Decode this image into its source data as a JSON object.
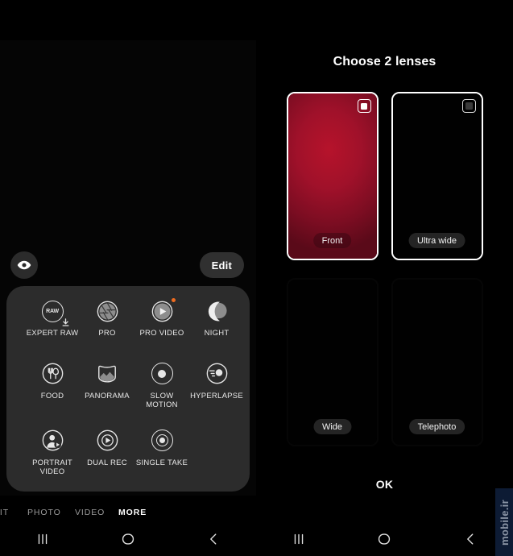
{
  "left": {
    "eye_icon": "eye-icon",
    "edit_label": "Edit",
    "modes": [
      {
        "label": "EXPERT RAW",
        "icon": "raw-download-icon",
        "badge": false
      },
      {
        "label": "PRO",
        "icon": "aperture-icon",
        "badge": false
      },
      {
        "label": "PRO VIDEO",
        "icon": "play-circle-icon",
        "badge": true
      },
      {
        "label": "NIGHT",
        "icon": "moon-icon",
        "badge": false
      },
      {
        "label": "FOOD",
        "icon": "fork-spoon-icon",
        "badge": false
      },
      {
        "label": "PANORAMA",
        "icon": "panorama-icon",
        "badge": false
      },
      {
        "label": "SLOW\nMOTION",
        "icon": "slow-motion-icon",
        "badge": false
      },
      {
        "label": "HYPERLAPSE",
        "icon": "hyperlapse-icon",
        "badge": false
      },
      {
        "label": "PORTRAIT\nVIDEO",
        "icon": "portrait-video-icon",
        "badge": false
      },
      {
        "label": "DUAL REC",
        "icon": "dual-rec-icon",
        "badge": false
      },
      {
        "label": "SINGLE TAKE",
        "icon": "single-take-icon",
        "badge": false
      }
    ],
    "tabs": [
      {
        "label": "AIT",
        "active": false
      },
      {
        "label": "PHOTO",
        "active": false
      },
      {
        "label": "VIDEO",
        "active": false
      },
      {
        "label": "MORE",
        "active": true
      }
    ]
  },
  "right": {
    "title": "Choose 2 lenses",
    "lenses": [
      {
        "label": "Front",
        "selected": true,
        "checkbox": "checked",
        "preview": "red"
      },
      {
        "label": "Ultra wide",
        "selected": true,
        "checkbox": "unchecked",
        "preview": "black"
      },
      {
        "label": "Wide",
        "selected": false,
        "checkbox": "none",
        "preview": "black"
      },
      {
        "label": "Telephoto",
        "selected": false,
        "checkbox": "none",
        "preview": "black"
      }
    ],
    "ok_label": "OK"
  },
  "navbar": {
    "recents": "recents-icon",
    "home": "home-icon",
    "back": "back-icon"
  },
  "watermark": {
    "text": "mobile.ir"
  },
  "colors": {
    "accent_orange": "#ef6c20",
    "sheet_bg": "#2c2c2c",
    "lens_red": "#b6132b",
    "watermark_bg": "#0d1b34"
  }
}
